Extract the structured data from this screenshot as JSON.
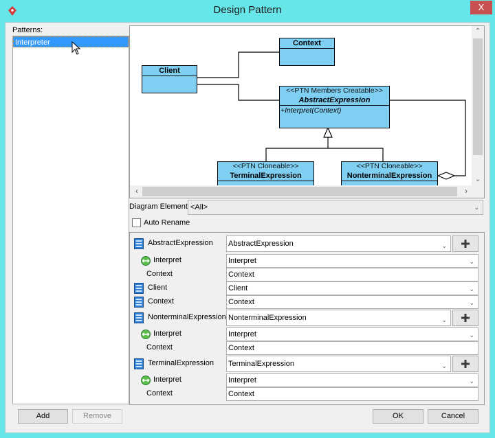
{
  "window": {
    "title": "Design Pattern",
    "close_label": "X",
    "colors": {
      "frame": "#67e6ea",
      "close": "#c75050",
      "uml_fill": "#7fcff3",
      "selection": "#3399ff"
    }
  },
  "patterns": {
    "label": "Patterns:",
    "items": [
      {
        "label": "Interpreter",
        "selected": true
      }
    ]
  },
  "diagram": {
    "classes": {
      "context": {
        "name": "Context"
      },
      "client": {
        "name": "Client"
      },
      "abstract": {
        "stereotype": "<<PTN Members Creatable>>",
        "name": "AbstractExpression",
        "operation": "+Interpret(Context)"
      },
      "terminal": {
        "stereotype": "<<PTN Cloneable>>",
        "name": "TerminalExpression"
      },
      "nonterminal": {
        "stereotype": "<<PTN Cloneable>>",
        "name": "NonterminalExpression"
      }
    }
  },
  "diagram_element": {
    "label": "Diagram Element",
    "value": "<All>"
  },
  "auto_rename": {
    "label": "Auto Rename",
    "checked": false
  },
  "mapping": {
    "rows": [
      {
        "type": "class",
        "label": "AbstractExpression",
        "value": "AbstractExpression",
        "dropdown": true,
        "add": true
      },
      {
        "type": "operation",
        "label": "Interpret",
        "value": "Interpret",
        "dropdown": true
      },
      {
        "type": "parameter",
        "label": "Context",
        "value": "Context",
        "dropdown": false
      },
      {
        "type": "class",
        "label": "Client",
        "value": "Client",
        "dropdown": true
      },
      {
        "type": "class",
        "label": "Context",
        "value": "Context",
        "dropdown": true
      },
      {
        "type": "class",
        "label": "NonterminalExpression",
        "value": "NonterminalExpression",
        "dropdown": true,
        "add": true
      },
      {
        "type": "operation",
        "label": "Interpret",
        "value": "Interpret",
        "dropdown": true
      },
      {
        "type": "parameter",
        "label": "Context",
        "value": "Context",
        "dropdown": false
      },
      {
        "type": "class",
        "label": "TerminalExpression",
        "value": "TerminalExpression",
        "dropdown": true,
        "add": true
      },
      {
        "type": "operation",
        "label": "Interpret",
        "value": "Interpret",
        "dropdown": true
      },
      {
        "type": "parameter",
        "label": "Context",
        "value": "Context",
        "dropdown": false
      }
    ]
  },
  "buttons": {
    "add": "Add",
    "remove": "Remove",
    "ok": "OK",
    "cancel": "Cancel"
  }
}
